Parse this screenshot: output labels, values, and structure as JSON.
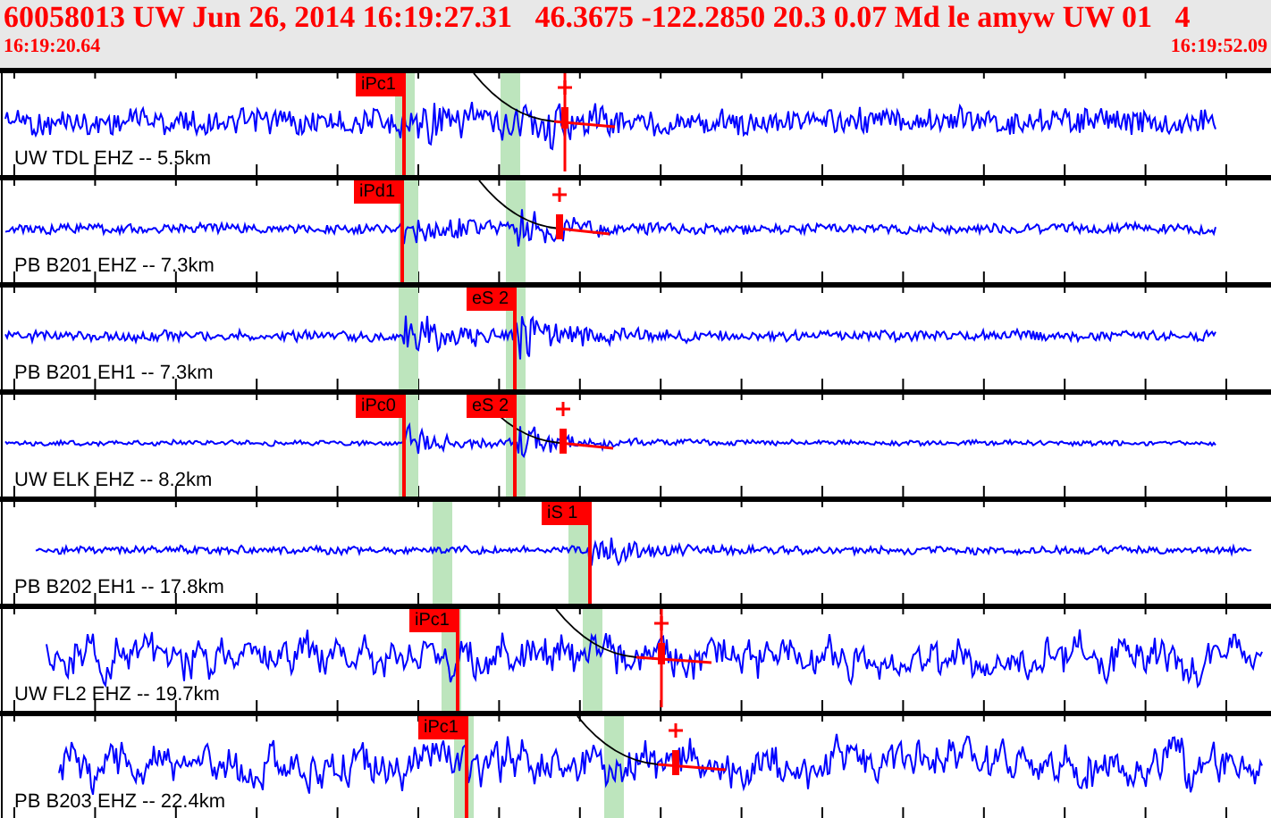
{
  "header": {
    "title": "60058013 UW Jun 26, 2014 16:19:27.31   46.3675 -122.2850 20.3 0.07 Md le amyw UW 01   4",
    "start_time": "16:19:20.64",
    "end_time": "16:19:52.09"
  },
  "traces": [
    {
      "label": "UW TDL EHZ -- 5.5km",
      "picks": [
        {
          "label": "iPc1"
        }
      ]
    },
    {
      "label": "PB B201 EHZ -- 7.3km",
      "picks": [
        {
          "label": "iPd1"
        }
      ]
    },
    {
      "label": "PB B201 EH1 -- 7.3km",
      "picks": [
        {
          "label": "eS 2"
        }
      ]
    },
    {
      "label": "UW ELK EHZ -- 8.2km",
      "picks": [
        {
          "label": "iPc0"
        },
        {
          "label": "eS 2"
        }
      ]
    },
    {
      "label": "PB B202 EH1 -- 17.8km",
      "picks": [
        {
          "label": "iS 1"
        }
      ]
    },
    {
      "label": "UW FL2 EHZ -- 19.7km",
      "picks": [
        {
          "label": "iPc1"
        }
      ]
    },
    {
      "label": "PB B203 EHZ -- 22.4km",
      "picks": [
        {
          "label": "iPc1"
        }
      ]
    }
  ]
}
